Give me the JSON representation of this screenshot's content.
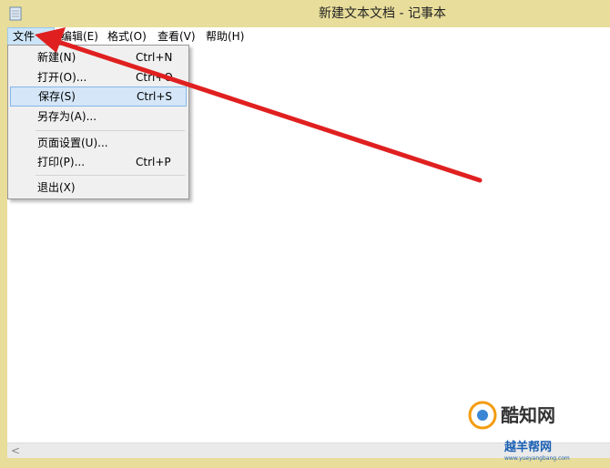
{
  "window": {
    "title": "新建文本文档 - 记事本"
  },
  "menubar": {
    "items": [
      {
        "label": "文件(F)"
      },
      {
        "label": "编辑(E)"
      },
      {
        "label": "格式(O)"
      },
      {
        "label": "查看(V)"
      },
      {
        "label": "帮助(H)"
      }
    ]
  },
  "file_menu": {
    "items": [
      {
        "label": "新建(N)",
        "shortcut": "Ctrl+N"
      },
      {
        "label": "打开(O)...",
        "shortcut": "Ctrl+O"
      },
      {
        "label": "保存(S)",
        "shortcut": "Ctrl+S"
      },
      {
        "label": "另存为(A)...",
        "shortcut": ""
      },
      {
        "label": "页面设置(U)...",
        "shortcut": ""
      },
      {
        "label": "打印(P)...",
        "shortcut": "Ctrl+P"
      },
      {
        "label": "退出(X)",
        "shortcut": ""
      }
    ]
  },
  "annotation": {
    "color": "#e02020"
  },
  "watermark": {
    "name": "酷知网",
    "brand": "越羊帮网",
    "url": "www.yueyangbang.com"
  }
}
